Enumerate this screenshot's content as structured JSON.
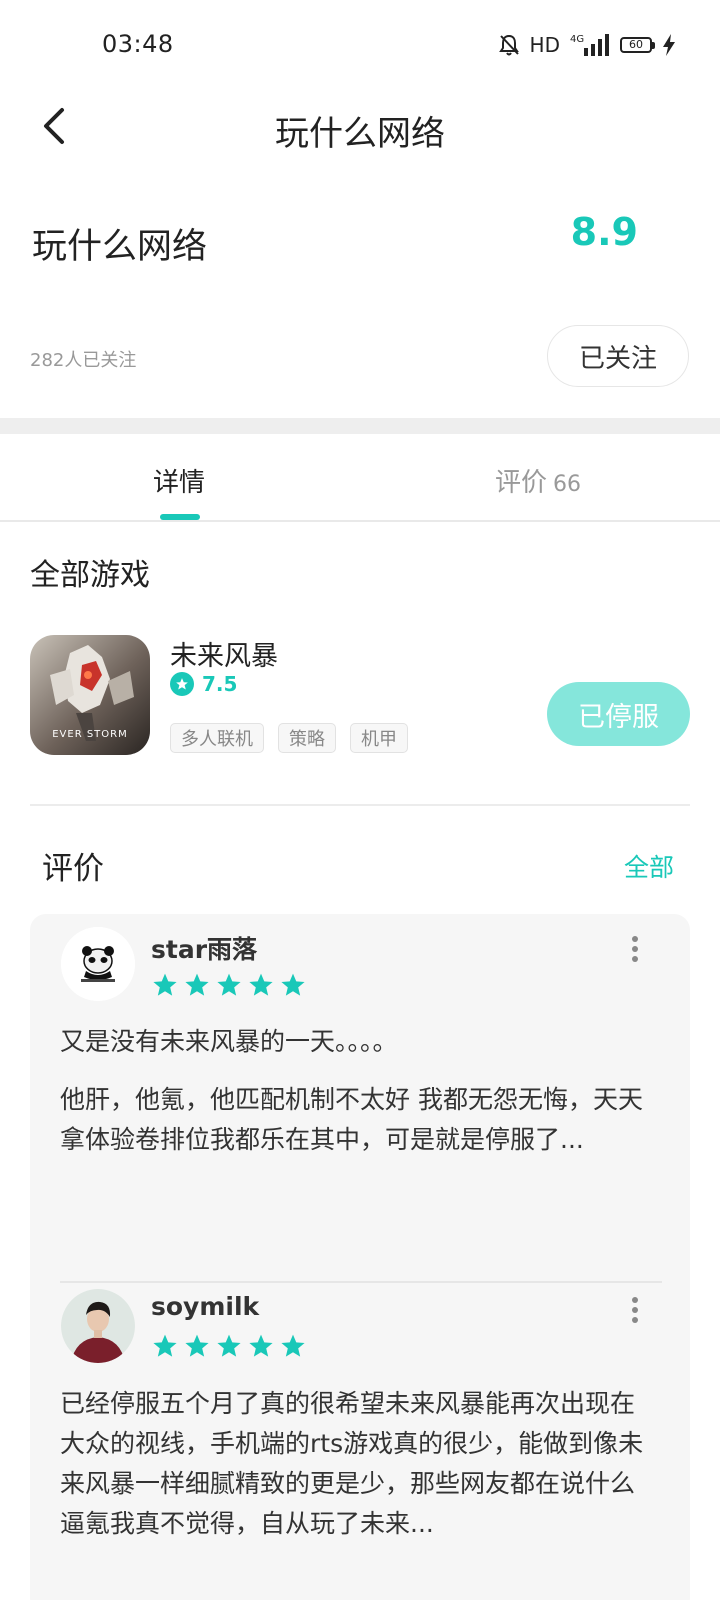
{
  "status_bar": {
    "time": "03:48",
    "hd": "HD",
    "network": "4G",
    "battery": "60"
  },
  "nav": {
    "title": "玩什么网络"
  },
  "header": {
    "name": "玩什么网络",
    "score": "8.9",
    "followers": "282人已关注",
    "follow_button": "已关注"
  },
  "tabs": {
    "details": "详情",
    "reviews": "评价",
    "reviews_count": "66"
  },
  "games": {
    "section_title": "全部游戏",
    "items": [
      {
        "name": "未来风暴",
        "rating": "7.5",
        "tags": [
          "多人联机",
          "策略",
          "机甲"
        ],
        "button": "已停服",
        "icon_text": "EVER STORM"
      }
    ]
  },
  "reviews": {
    "title": "评价",
    "all_link": "全部",
    "items": [
      {
        "user": "star雨落",
        "stars": 5,
        "title": "又是没有未来风暴的一天。。。。",
        "body": "他肝，他氪，他匹配机制不太好 我都无怨无悔，天天拿体验卷排位我都乐在其中，可是就是停服了..."
      },
      {
        "user": "soymilk",
        "stars": 5,
        "body": "已经停服五个月了真的很希望未来风暴能再次出现在大众的视线，手机端的rts游戏真的很少，能做到像未来风暴一样细腻精致的更是少，那些网友都在说什么逼氪我真不觉得，自从玩了未来..."
      }
    ]
  },
  "colors": {
    "accent": "#19c8b8",
    "stopped_button": "#85e6db",
    "card_bg": "#f6f6f6"
  }
}
